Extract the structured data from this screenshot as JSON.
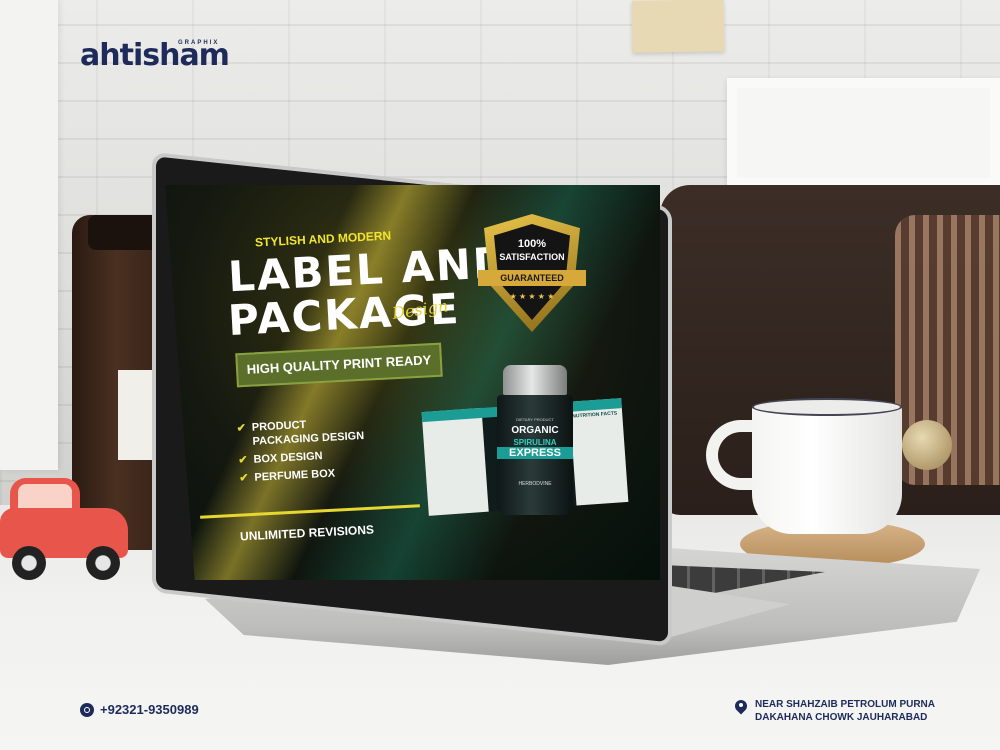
{
  "logo": {
    "main": "ahtisham",
    "sub": "GRAPHIX"
  },
  "screen": {
    "kicker": "STYLISH AND MODERN",
    "title_line1": "LABEL AND",
    "title_line2": "PACKAGE",
    "script": "Design",
    "banner": "HIGH QUALITY PRINT READY",
    "services": [
      "PRODUCT PACKAGING DESIGN",
      "BOX DESIGN",
      "PERFUME BOX"
    ],
    "revisions": "UNLIMITED REVISIONS"
  },
  "badge": {
    "percent": "100%",
    "text": "SATISFACTION",
    "ribbon": "GUARANTEED",
    "stars": "★ ★ ★ ★ ★"
  },
  "product": {
    "small": "DIETARY PRODUCT",
    "line1": "ORGANIC",
    "line2": "SPIRULINA",
    "line3": "EXPRESS",
    "brand": "HERBODVINE",
    "panel": "NUTRITION FACTS"
  },
  "contact": {
    "phone": "+92321-9350989",
    "address_line1": "NEAR SHAHZAIB PETROLUM PURNA",
    "address_line2": "DAKAHANA CHOWK  JAUHARABAD"
  },
  "colors": {
    "brand_navy": "#1e2b5a",
    "accent_yellow": "#e6d830",
    "accent_teal": "#1b9d95"
  }
}
